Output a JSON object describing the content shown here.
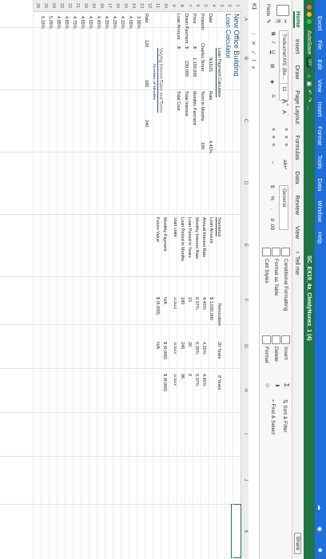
{
  "menubar": {
    "app": "Excel",
    "items": [
      "File",
      "Edit",
      "View",
      "Insert",
      "Format",
      "Tools",
      "Data",
      "Window",
      "Help"
    ]
  },
  "titlebar": {
    "autosave_label": "AutoSave",
    "autosave_state": "OFF",
    "document": "SC_EX19_4a_CleidyNunez_1 (4)"
  },
  "tabs": [
    "Home",
    "Insert",
    "Draw",
    "Page Layout",
    "Formulas",
    "Data",
    "Review",
    "View"
  ],
  "tell_me": "Tell me",
  "share": "Share",
  "ribbon": {
    "paste": "Paste",
    "font_name": "Trebuchet MS (Bo...",
    "font_size": "11",
    "number_format": "General",
    "conditional_formatting": "Conditional Formatting",
    "format_as_table": "Format as Table",
    "cell_styles": "Cell Styles",
    "insert": "Insert",
    "delete": "Delete",
    "format": "Format",
    "sort_filter": "Sort & Filter",
    "find_select": "Find & Select"
  },
  "formula_bar": {
    "name_box": "K1",
    "fx": "fx",
    "value": ""
  },
  "columns": [
    "A",
    "B",
    "C",
    "D",
    "E",
    "F",
    "G",
    "H",
    "I",
    "J",
    "K"
  ],
  "rows": [
    "1",
    "2",
    "3",
    "4",
    "5",
    "6",
    "7",
    "8",
    "9",
    "10",
    "11",
    "12",
    "13",
    "14",
    "15",
    "16",
    "17",
    "18",
    "19",
    "20",
    "21",
    "22",
    "23",
    "24",
    "25",
    "26"
  ],
  "sheet": {
    "title": "New Office Building",
    "subtitle": "Loan Calculator",
    "calc_header": "Loan Payment Calculator",
    "left_labels": [
      "Date",
      "Property",
      "Price",
      "Down Payment",
      "Loan Amount"
    ],
    "left_values": [
      "9/15/21",
      "Charles Street",
      "1,150,000",
      "230,000",
      ""
    ],
    "left_currency": [
      "",
      "",
      "$",
      "$",
      "$"
    ],
    "mid_labels": [
      "Rate",
      "Term in Months",
      "Monthly Payment",
      "Total Interest",
      "Total Cost"
    ],
    "mid_values": [
      "4.45%",
      "180",
      "",
      "",
      ""
    ],
    "varying_title": "Varying Interest Rates and Terms",
    "months_label": "Number of Months",
    "rate_label": "Rate",
    "months": [
      "120",
      "180",
      "240"
    ],
    "rates": [
      "3.95%",
      "4.05%",
      "4.15%",
      "4.25%",
      "4.35%",
      "4.45%",
      "4.55%",
      "4.65%",
      "4.75%",
      "4.85%",
      "4.95%",
      "5.05%",
      "5.15%"
    ],
    "scenarios_header": "Scenarios",
    "scenario_cols": [
      "Renovation",
      "20 Years",
      "8 Years"
    ],
    "scenario_labels": [
      "Loan Amount",
      "Annual Interest Rate",
      "Monthly Interest Rate",
      "Loan Period in Years",
      "Loan Period in Months",
      "Start Date",
      "Monthly Payment",
      "Future Value"
    ],
    "renovation": [
      "$ 1,020,000",
      "4.45%",
      "0.37%",
      "15",
      "180",
      "1/3/22",
      "N/A",
      "$ (6,000)"
    ],
    "twenty_years": [
      "",
      "4.25%",
      "0.35%",
      "20",
      "240",
      "1/3/22",
      "$ (6,000)",
      "N/A"
    ],
    "eight_years": [
      "",
      "4.45%",
      "0.37%",
      "8",
      "96",
      "1/3/22",
      "$ (8,000)",
      ""
    ]
  }
}
